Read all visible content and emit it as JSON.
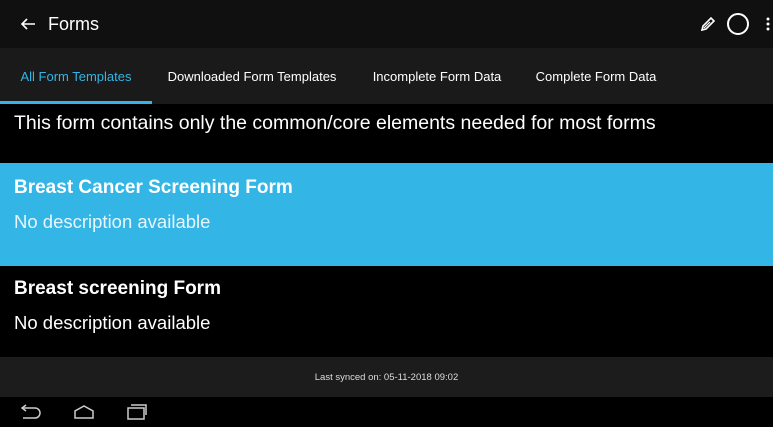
{
  "appbar": {
    "title": "Forms",
    "icons": [
      "back-arrow-icon",
      "pencil-icon",
      "sync-circle-icon",
      "overflow-menu-icon"
    ]
  },
  "tabs": [
    {
      "label": "All Form Templates",
      "active": true
    },
    {
      "label": "Downloaded Form Templates",
      "active": false
    },
    {
      "label": "Incomplete Form Data",
      "active": false
    },
    {
      "label": "Complete Form Data",
      "active": false
    }
  ],
  "list": {
    "partial_text": "This form contains only the common/core elements needed for most forms",
    "items": [
      {
        "title": "Breast Cancer Screening Form",
        "description": "No description available",
        "selected": true
      },
      {
        "title": "Breast screening Form",
        "description": "No description available",
        "selected": false
      }
    ]
  },
  "footer": {
    "sync_text": "Last synced on: 05-11-2018 09:02"
  },
  "navbar": {
    "icons": [
      "nav-back-icon",
      "nav-home-icon",
      "nav-recent-apps-icon"
    ]
  },
  "colors": {
    "accent": "#33b5e5",
    "appbar": "#101010",
    "tabbar": "#1a1a1a",
    "footer": "#1c1c1c",
    "background": "#000000"
  }
}
